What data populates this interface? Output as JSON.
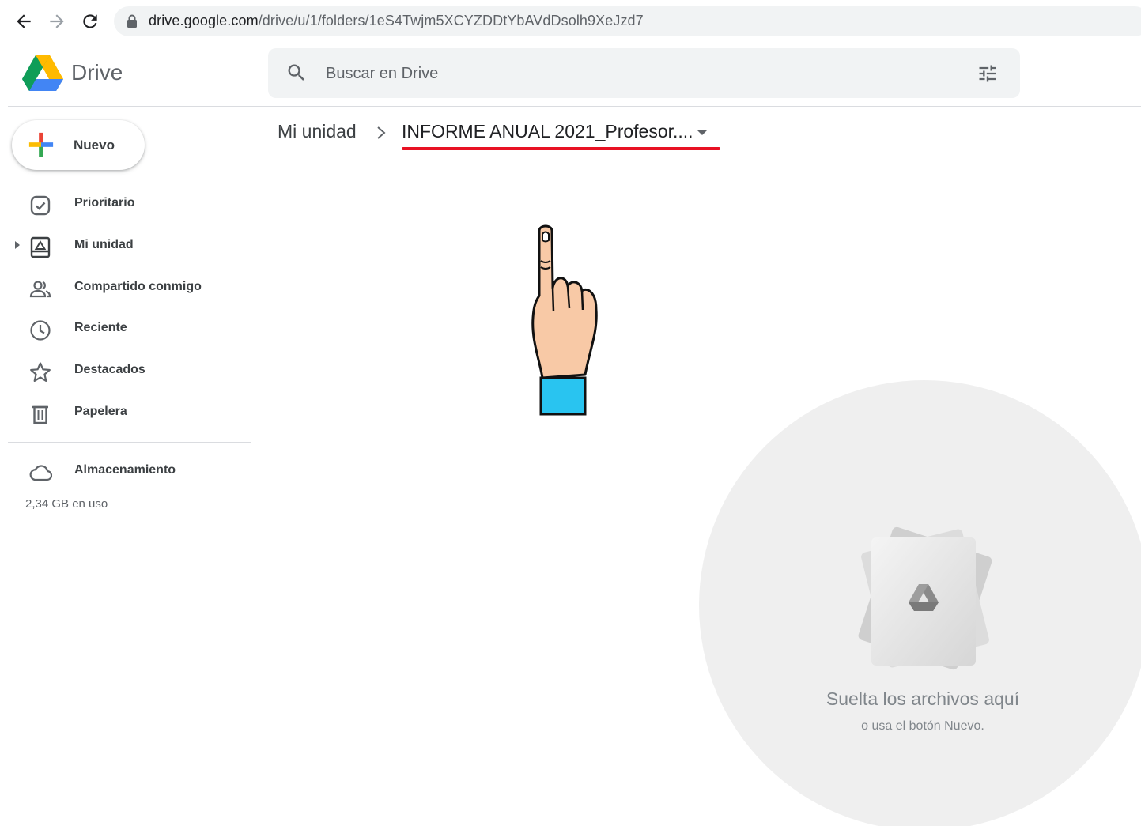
{
  "browser": {
    "url_host": "drive.google.com",
    "url_path": "/drive/u/1/folders/1eS4Twjm5XCYZDDtYbAVdDsolh9XeJzd7"
  },
  "header": {
    "app_name": "Drive",
    "search_placeholder": "Buscar en Drive"
  },
  "sidebar": {
    "new_label": "Nuevo",
    "items": [
      {
        "label": "Prioritario",
        "icon": "priority-check-icon"
      },
      {
        "label": "Mi unidad",
        "icon": "my-drive-icon"
      },
      {
        "label": "Compartido conmigo",
        "icon": "shared-people-icon"
      },
      {
        "label": "Reciente",
        "icon": "clock-icon"
      },
      {
        "label": "Destacados",
        "icon": "star-icon"
      },
      {
        "label": "Papelera",
        "icon": "trash-icon"
      }
    ],
    "storage": {
      "label": "Almacenamiento",
      "usage": "2,34 GB en uso",
      "icon": "cloud-icon"
    }
  },
  "breadcrumb": {
    "root": "Mi unidad",
    "current": "INFORME ANUAL 2021_Profesor...."
  },
  "dropzone": {
    "title": "Suelta los archivos aquí",
    "subtitle": "o usa el botón Nuevo."
  },
  "colors": {
    "accent_underline": "#e81123",
    "hand_skin": "#f8c9a6",
    "hand_cuff": "#29c4f0"
  }
}
